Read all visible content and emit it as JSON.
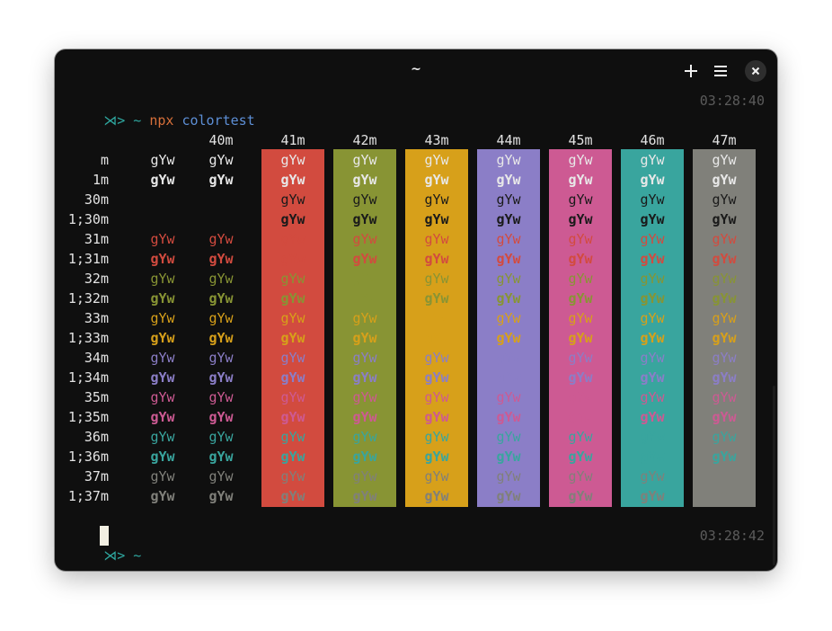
{
  "window": {
    "title": "~"
  },
  "titlebar_buttons": [
    {
      "name": "new-tab-button",
      "icon": "plus-icon"
    },
    {
      "name": "menu-button",
      "icon": "hamburger-menu-icon"
    },
    {
      "name": "close-button",
      "icon": "close-icon"
    }
  ],
  "prompt1": {
    "symbol": "⋊>",
    "dir": "~",
    "command": "npx",
    "argument": "colortest",
    "time": "03:28:40"
  },
  "prompt2": {
    "symbol": "⋊>",
    "dir": "~",
    "time": "03:28:42"
  },
  "sample_text": "gYw",
  "colortest": {
    "column_headers": [
      "",
      "",
      "40m",
      "41m",
      "42m",
      "43m",
      "44m",
      "45m",
      "46m",
      "47m"
    ],
    "row_labels": [
      "m",
      "1m",
      "30m",
      "1;30m",
      "31m",
      "1;31m",
      "32m",
      "1;32m",
      "33m",
      "1;33m",
      "34m",
      "1;34m",
      "35m",
      "1;35m",
      "36m",
      "1;36m",
      "37m",
      "1;37m"
    ],
    "bg_colors": {
      "41m": "#d24b3f",
      "42m": "#889434",
      "43m": "#d7a01a",
      "44m": "#8b7ec7",
      "45m": "#cd5a93",
      "46m": "#39a59e",
      "47m": "#80807a"
    },
    "fg_colors": {
      "default": "#e8e8e8",
      "30": "#1a1a1a",
      "31": "#d24b3f",
      "32": "#889434",
      "33": "#d7a01a",
      "34": "#8b7ec7",
      "35": "#cd5a93",
      "36": "#39a59e",
      "37": "#80807a"
    }
  }
}
